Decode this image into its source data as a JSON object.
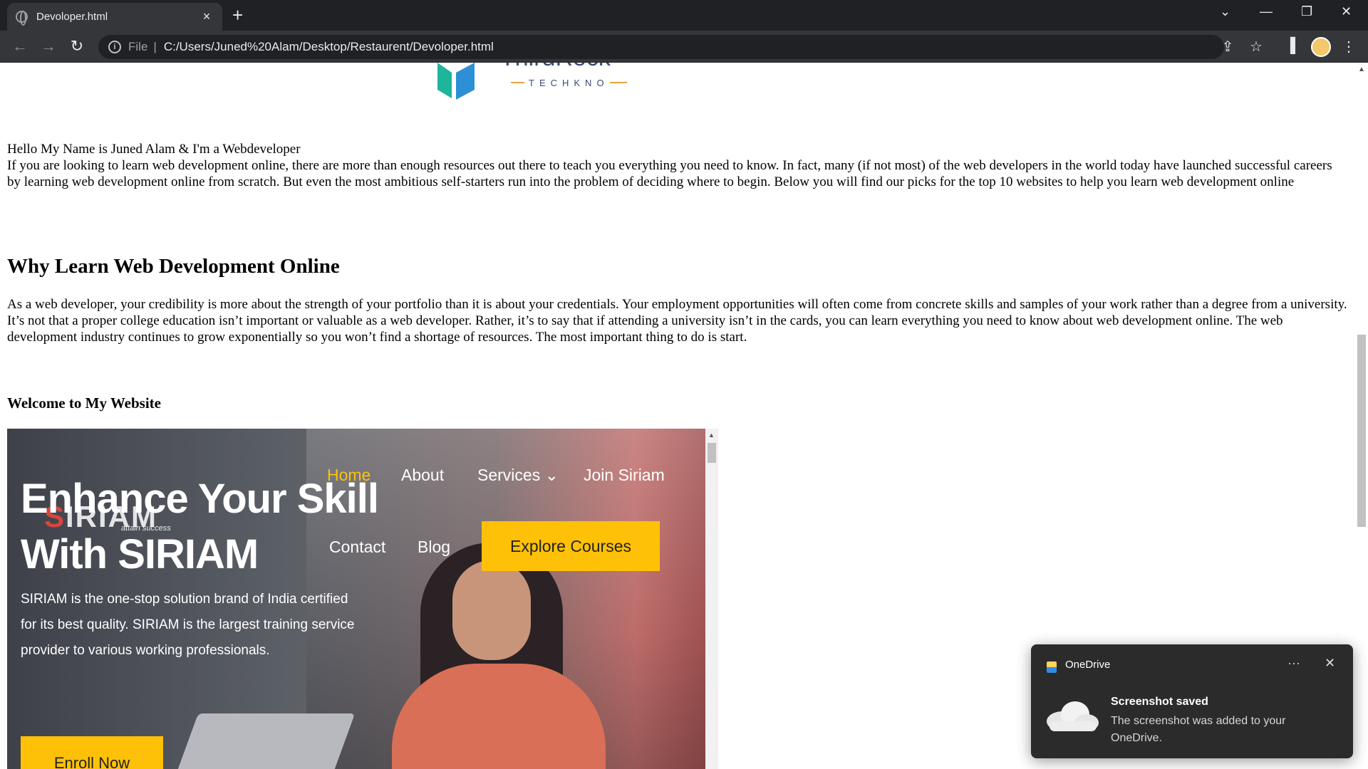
{
  "browser": {
    "tab_title": "Devoloper.html",
    "tab_close": "×",
    "new_tab": "+",
    "scheme": "File",
    "separator": "|",
    "url": "C:/Users/Juned%20Alam/Desktop/Restaurent/Devoloper.html"
  },
  "page": {
    "logo_text": "ThirdRock",
    "logo_sub": "TECHKNO",
    "intro_line1": "Hello My Name is Juned Alam & I'm a Webdeveloper",
    "intro_text": "If you are looking to learn web development online, there are more than enough resources out there to teach you everything you need to know. In fact, many (if not most) of the web developers in the world today have launched successful careers by learning web development online from scratch. But even the most ambitious self-starters run into the problem of deciding where to begin. Below you will find our picks for the top 10 websites to help you learn web development online",
    "heading": "Why Learn Web Development Online",
    "para2": "As a web developer, your credibility is more about the strength of your portfolio than it is about your credentials. Your employment opportunities will often come from concrete skills and samples of your work rather than a degree from a university. It’s not that a proper college education isn’t important or valuable as a web developer. Rather, it’s to say that if attending a university isn’t in the cards, you can learn everything you need to know about web development online. The web development industry continues to grow exponentially so you won’t find a shortage of resources. The most important thing to do is start.",
    "subheading": "Welcome to My Website"
  },
  "embed": {
    "title_line1": "Enhance Your Skill",
    "title_line2": "With SIRIAM",
    "brand_s": "S",
    "brand_rest": "IRIAM",
    "tagline": "attain success",
    "description": "SIRIAM is the one-stop solution brand of India certified for its best quality. SIRIAM is the largest training service provider to various working professionals.",
    "nav": {
      "home": "Home",
      "about": "About",
      "services": "Services ⌄",
      "join": "Join Siriam",
      "contact": "Contact",
      "blog": "Blog"
    },
    "explore_label": "Explore Courses",
    "enroll_label": "Enroll Now",
    "accent": "#ffc107"
  },
  "toast": {
    "app": "OneDrive",
    "more": "···",
    "close": "✕",
    "title": "Screenshot saved",
    "message": "The screenshot was added to your OneDrive."
  }
}
